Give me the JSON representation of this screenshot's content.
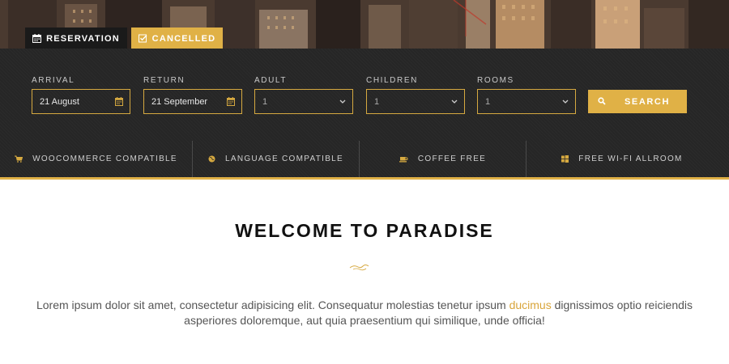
{
  "tabs": {
    "reservation": {
      "label": "Reservation",
      "icon": "calendar-icon"
    },
    "cancelled": {
      "label": "Cancelled",
      "icon": "checkbox-icon"
    }
  },
  "form": {
    "arrival": {
      "label": "Arrival",
      "value": "21 August",
      "icon": "calendar-icon"
    },
    "return": {
      "label": "Return",
      "value": "21 September",
      "icon": "calendar-icon"
    },
    "adult": {
      "label": "Adult",
      "value": "1",
      "icon": "chevron-down-icon"
    },
    "children": {
      "label": "Children",
      "value": "1",
      "icon": "chevron-down-icon"
    },
    "rooms": {
      "label": "Rooms",
      "value": "1",
      "icon": "chevron-down-icon"
    },
    "search_label": "Search"
  },
  "features": [
    {
      "label": "WooCommerce Compatible",
      "icon": "cart-icon"
    },
    {
      "label": "Language Compatible",
      "icon": "globe-icon"
    },
    {
      "label": "Coffee Free",
      "icon": "coffee-icon"
    },
    {
      "label": "Free Wi-Fi Allroom",
      "icon": "windows-icon"
    }
  ],
  "welcome": {
    "title": "Welcome to Paradise",
    "text_before": "Lorem ipsum dolor sit amet, consectetur adipisicing elit. Consequatur molestias tenetur ipsum ",
    "text_highlight": "ducimus",
    "text_after": " dignissimos optio reiciendis asperiores doloremque, aut quia praesentium qui similique, unde officia!"
  },
  "colors": {
    "accent": "#e0b146",
    "panel": "#262626",
    "tab_dark": "#1a1a1a",
    "title": "#111111",
    "body_text": "#555555"
  }
}
